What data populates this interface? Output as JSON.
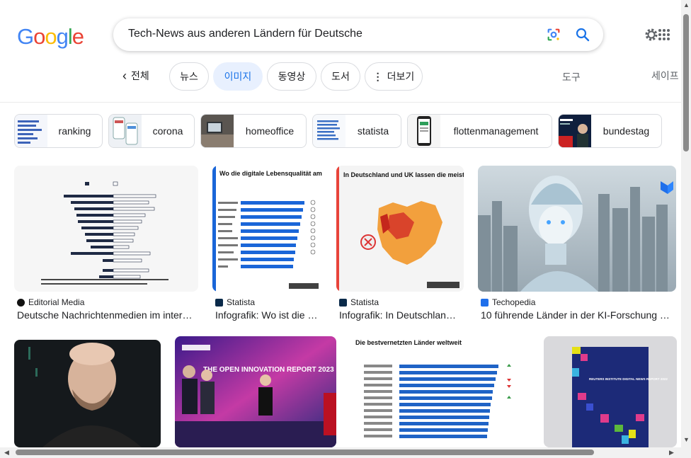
{
  "header": {
    "logo": "Google",
    "query": "Tech-News aus anderen Ländern für Deutsche"
  },
  "tabs": {
    "back_label": "전체",
    "items": [
      "뉴스",
      "이미지",
      "동영상",
      "도서",
      "더보기"
    ],
    "active": "이미지",
    "tools_label": "도구",
    "safe_label": "세이프"
  },
  "related": [
    "ranking",
    "corona",
    "homeoffice",
    "statista",
    "flottenmanagement",
    "bundestag"
  ],
  "results": [
    {
      "source": "Editorial Media",
      "title": "Deutsche Nachrichtenmedien im inter…"
    },
    {
      "source": "Statista",
      "title": "Infografik: Wo ist die …"
    },
    {
      "source": "Statista",
      "title": "Infografik: In Deutschlan…"
    },
    {
      "source": "Techopedia",
      "title": "10 führende Länder in der KI-Forschung …"
    }
  ],
  "thumb_text": {
    "statista1_title": "Wo die digitale Lebensqualität am höchsten ist",
    "statista2_title": "In Deutschland und UK lassen die meisten Firmen Federn",
    "itu_title": "Die bestvernetzten Länder weltweit",
    "sopra_text": "THE OPEN INNOVATION REPORT 2023",
    "reuters_text": "REUTERS INSTITUTE DIGITAL NEWS REPORT 2022"
  },
  "colors": {
    "accent": "#1a73e8",
    "active_chip_bg": "#e8f0fe"
  }
}
